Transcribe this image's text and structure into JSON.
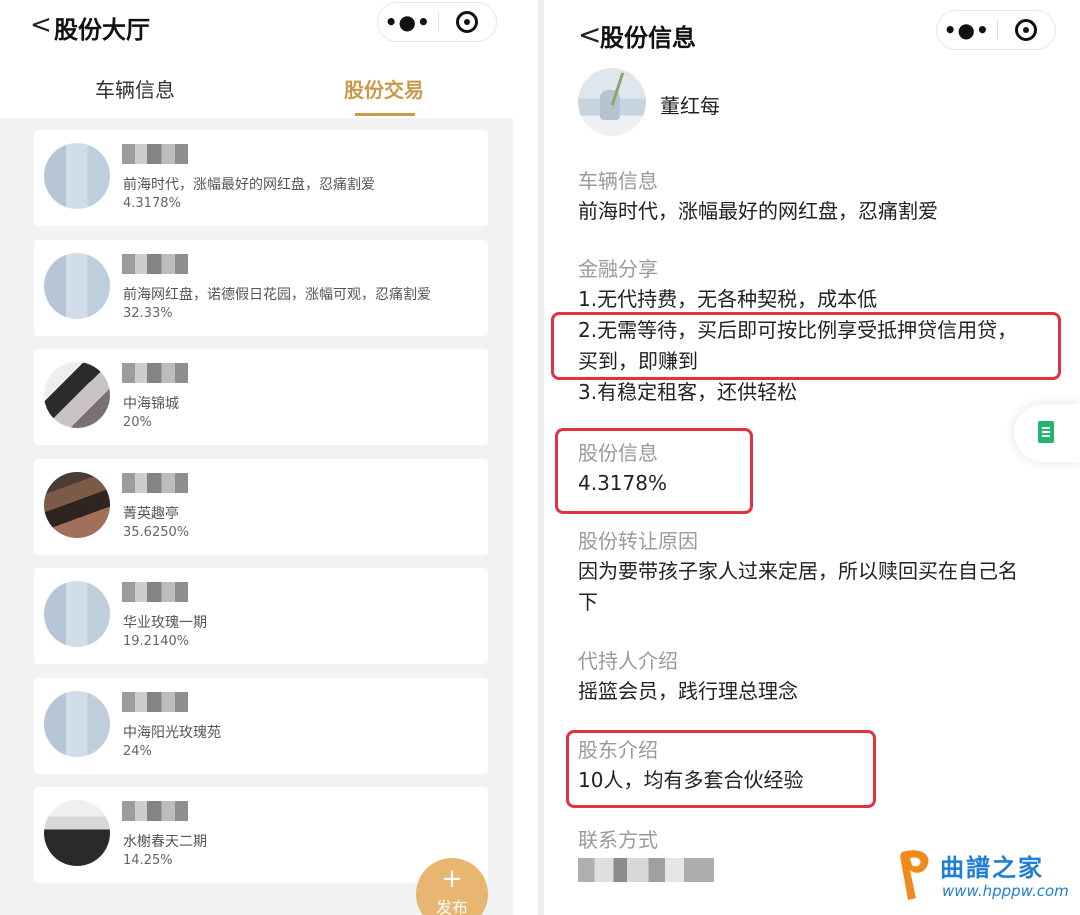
{
  "left": {
    "title": "股份大厅",
    "tabs": [
      "车辆信息",
      "股份交易"
    ],
    "active_tab_index": 1,
    "items": [
      {
        "desc": "前海时代，涨幅最好的网红盘，忍痛割爱",
        "pct": "4.3178%"
      },
      {
        "desc": "前海网红盘，诺德假日花园，涨幅可观，忍痛割爱",
        "pct": "32.33%"
      },
      {
        "desc": "中海锦城",
        "pct": "20%"
      },
      {
        "desc": "菁英趣亭",
        "pct": "35.6250%"
      },
      {
        "desc": "华业玫瑰一期",
        "pct": "19.2140%"
      },
      {
        "desc": "中海阳光玫瑰苑",
        "pct": "24%"
      },
      {
        "desc": "水榭春天二期",
        "pct": "14.25%"
      }
    ],
    "fab": {
      "plus": "+",
      "label": "发布"
    }
  },
  "right": {
    "title": "股份信息",
    "user_name": "董红每",
    "sections": {
      "vehicle": {
        "label": "车辆信息",
        "value": "前海时代，涨幅最好的网红盘，忍痛割爱"
      },
      "finance": {
        "label": "金融分享",
        "line1": "1.无代持费，无各种契税，成本低",
        "line2": "2.无需等待，买后即可按比例享受抵押贷信用贷，",
        "line3": "买到，即赚到",
        "line4": "3.有稳定租客，还供轻松"
      },
      "share": {
        "label": "股份信息",
        "value": "4.3178%"
      },
      "reason": {
        "label": "股份转让原因",
        "line1": "因为要带孩子家人过来定居，所以赎回买在自己名",
        "line2": "下"
      },
      "agent": {
        "label": "代持人介绍",
        "value": "摇篮会员，践行理总理念"
      },
      "shareholders": {
        "label": "股东介绍",
        "value": "10人，均有多套合伙经验"
      },
      "contact": {
        "label": "联系方式"
      }
    }
  },
  "watermark": {
    "cn": "曲譜之家",
    "url": "www.hpppw.com"
  },
  "colors": {
    "accent_gold": "#c89b4a",
    "highlight_red": "#e0323f",
    "doc_green": "#26b36b",
    "watermark_blue": "#1f7fd6"
  }
}
